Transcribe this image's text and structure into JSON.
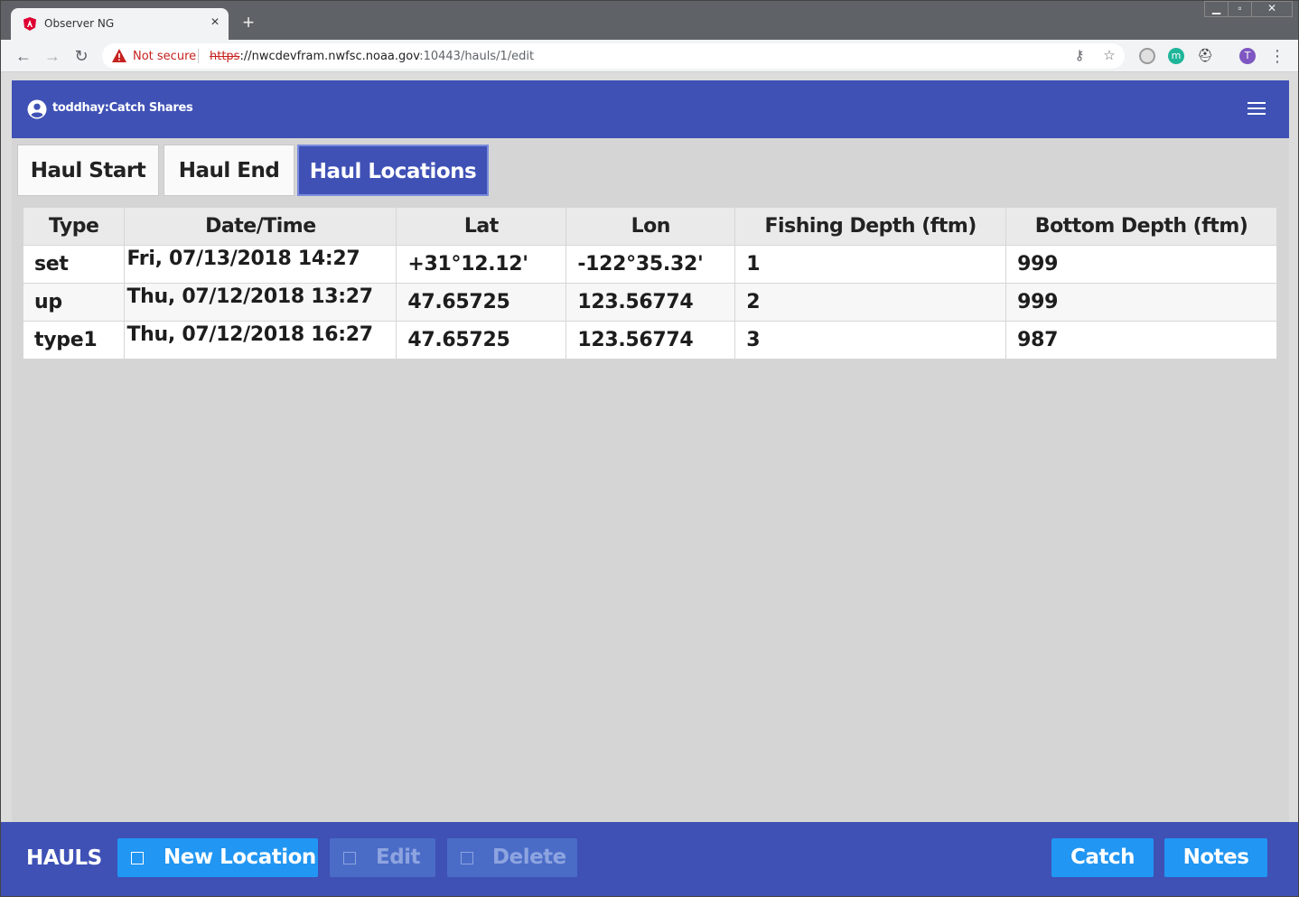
{
  "browser": {
    "tab_title": "Observer NG",
    "new_tab": "+",
    "close_tab": "×",
    "security_label": "Not secure",
    "url_scheme": "https",
    "url_rest": "://nwcdevfram.nwfsc.noaa.gov",
    "url_path": ":10443/hauls/1/edit",
    "profile_initial": "T",
    "ext_m": "m"
  },
  "app": {
    "user": "toddhay:Catch Shares",
    "tabs": [
      {
        "label": "Haul Start",
        "active": false
      },
      {
        "label": "Haul End",
        "active": false
      },
      {
        "label": "Haul Locations",
        "active": true
      }
    ],
    "columns": [
      "Type",
      "Date/Time",
      "Lat",
      "Lon",
      "Fishing Depth (ftm)",
      "Bottom Depth (ftm)"
    ],
    "rows": [
      [
        "set",
        "Fri, 07/13/2018 14:27",
        "+31°12.12'",
        "-122°35.32'",
        "1",
        "999"
      ],
      [
        "up",
        "Thu, 07/12/2018 13:27",
        "47.65725",
        "123.56774",
        "2",
        "999"
      ],
      [
        "type1",
        "Thu, 07/12/2018 16:27",
        "47.65725",
        "123.56774",
        "3",
        "987"
      ]
    ]
  },
  "bottom": {
    "section_label": "HAULS",
    "new_location": "New Location",
    "edit": "Edit",
    "delete": "Delete",
    "catch": "Catch",
    "notes": "Notes"
  },
  "colors": {
    "primary": "#3f51b5",
    "accent": "#2196f3",
    "insecure": "#c5221f"
  }
}
